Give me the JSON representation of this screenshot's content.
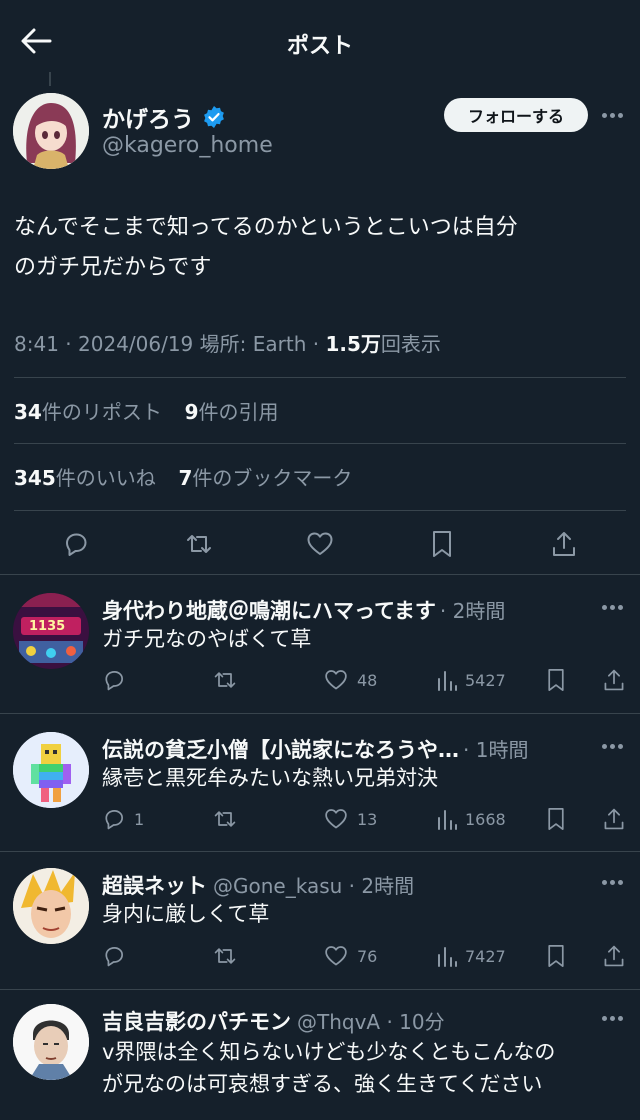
{
  "header": {
    "title": "ポスト"
  },
  "post": {
    "display_name": "かげろう",
    "handle": "@kagero_home",
    "follow_label": "フォローする",
    "text_line1": "なんでそこまで知ってるのかというとこいつは自分",
    "text_line2": "のガチ兄だからです",
    "time": "8:41",
    "date": "2024/06/19",
    "location": "場所: Earth",
    "views_count": "1.5万",
    "views_label": "回表示",
    "reposts_count": "34",
    "reposts_label": "件のリポスト",
    "quotes_count": "9",
    "quotes_label": "件の引用",
    "likes_count": "345",
    "likes_label": "件のいいね",
    "bookmarks_count": "7",
    "bookmarks_label": "件のブックマーク"
  },
  "replies": [
    {
      "name": "身代わり地蔵＠鳴潮にハマってます",
      "meta": "· 2時間",
      "text_lines": [
        "ガチ兄なのやばくて草"
      ],
      "replies": "",
      "likes": "48",
      "views": "5427",
      "avatar_badge": "1135"
    },
    {
      "name": "伝説の貧乏小僧【小説家になろうや…",
      "meta": "· 1時間",
      "text_lines": [
        "縁壱と黒死牟みたいな熱い兄弟対決"
      ],
      "replies": "1",
      "likes": "13",
      "views": "1668"
    },
    {
      "name": "超誤ネット",
      "meta": "@Gone_kasu · 2時間",
      "text_lines": [
        "身内に厳しくて草"
      ],
      "replies": "",
      "likes": "76",
      "views": "7427"
    },
    {
      "name": "吉良吉影のパチモン",
      "meta": "@ThqvA · 10分",
      "text_lines": [
        "v界隈は全く知らないけども少なくともこんなの",
        "が兄なのは可哀想すぎる、強く生きてください"
      ]
    }
  ],
  "icons": {
    "back": "back-arrow-icon",
    "verified": "verified-badge-icon",
    "reply": "reply-icon",
    "repost": "repost-icon",
    "like": "like-icon",
    "bookmark": "bookmark-icon",
    "share": "share-icon",
    "views": "views-icon",
    "more": "more-icon"
  },
  "colors": {
    "background": "#15202b",
    "text": "#f7f9f9",
    "muted": "#8b98a5",
    "divider": "#38444d",
    "verified": "#1d9bf0"
  }
}
